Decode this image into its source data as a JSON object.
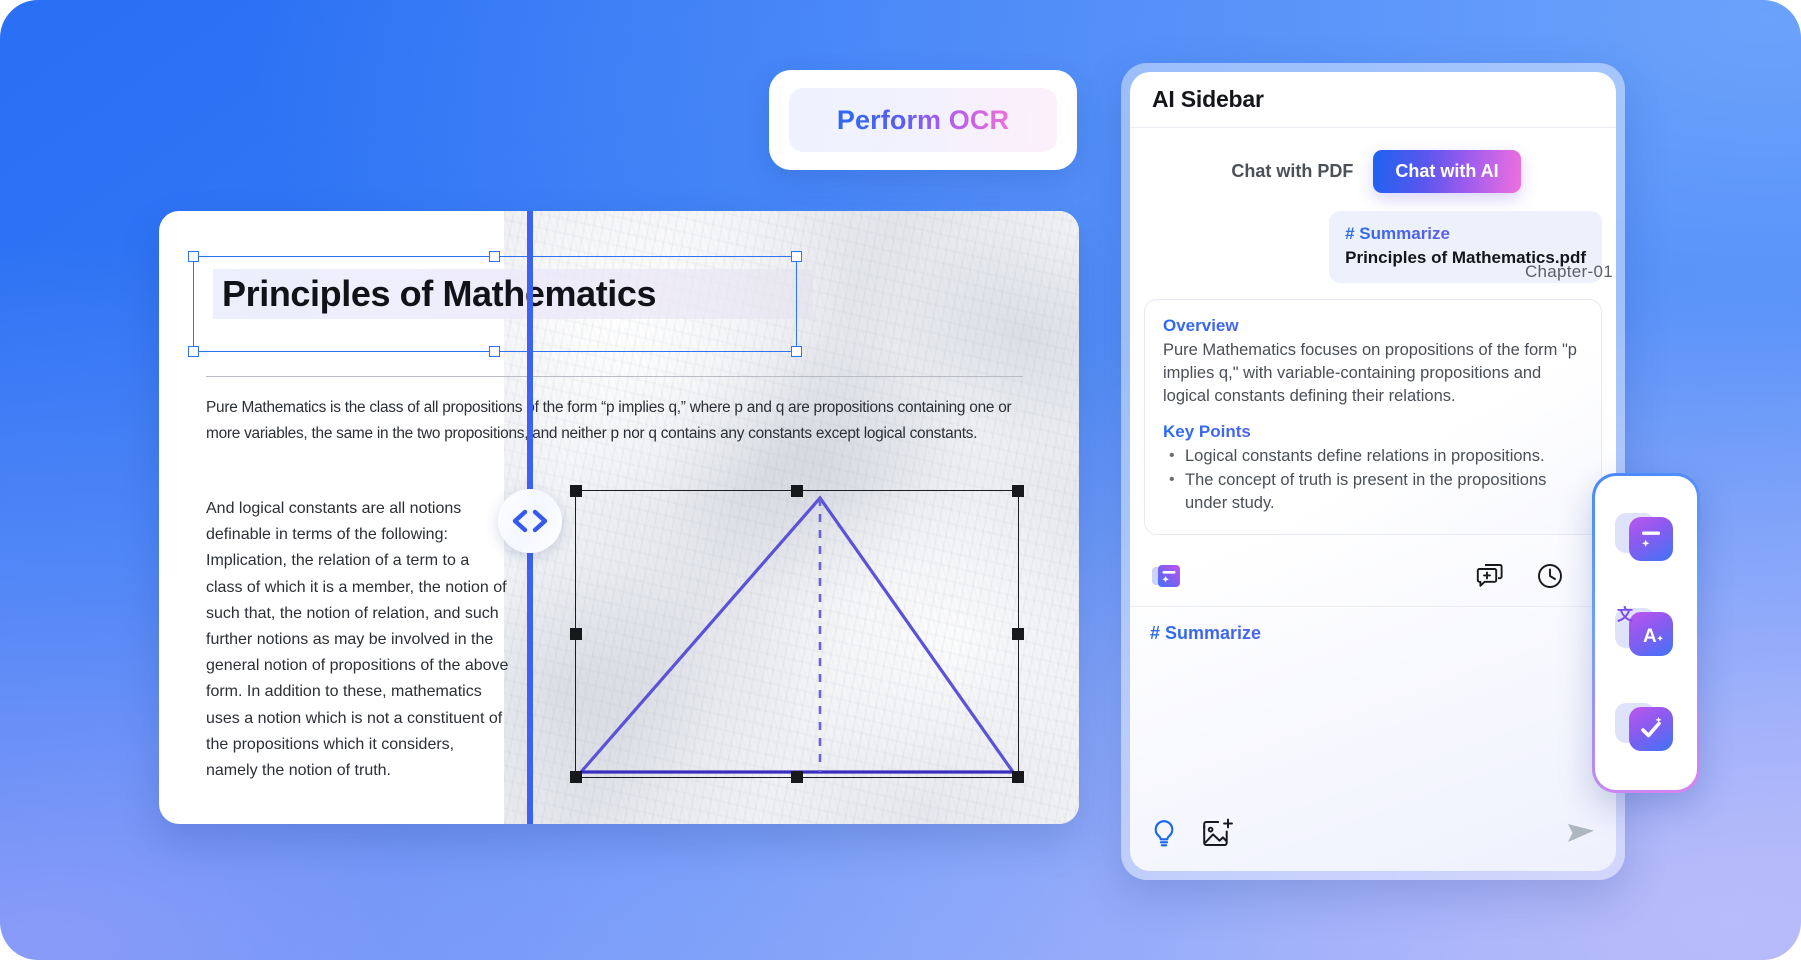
{
  "ocr": {
    "button_label": "Perform OCR"
  },
  "document": {
    "chapter_label": "Chapter-01",
    "title": "Principles of Mathematics",
    "paragraph_top": "Pure Mathematics is the class of all propositions of the form “p implies q,” where p and q are propositions containing one or more variables, the same in the two propositions, and neither p nor q contains any constants except logical constants.",
    "paragraph_left": "And logical constants are all notions definable in terms of the following: Implication, the relation of a term to a class of which it is a member, the notion of such that, the notion of relation, and such further notions as may be involved in the general notion of propositions of the above form. In addition to these, mathematics uses a notion which is not a constituent of the propositions which it considers, namely the notion of truth.",
    "split_handle_icon": "chevron-left-right-icon",
    "figure": {
      "name": "triangle-with-altitude",
      "stroke_color": "#5b52d8"
    },
    "selection_color": "#2f73f5"
  },
  "sidebar": {
    "title": "AI Sidebar",
    "tabs": [
      {
        "label": "Chat with PDF",
        "active": false
      },
      {
        "label": "Chat with AI",
        "active": true
      }
    ],
    "user_message": {
      "tag": "# Summarize",
      "file": "Principles of Mathematics.pdf"
    },
    "answer": {
      "overview_heading": "Overview",
      "overview_text": "Pure Mathematics focuses on propositions of the form \"p implies q,\" with variable-containing propositions and logical constants defining their relations.",
      "keypoints_heading": "Key Points",
      "keypoints": [
        "Logical constants define relations in propositions.",
        "The concept of truth is present in the propositions under study."
      ]
    },
    "toolbar": {
      "left_icon": "ai-assistant-icon",
      "right_icons": [
        "new-chat-icon",
        "history-clock-icon",
        "settings-icon"
      ]
    },
    "composer": {
      "tag": "# Summarize",
      "lightbulb_icon": "lightbulb-icon",
      "image_icon": "add-image-icon",
      "send_icon": "send-icon"
    }
  },
  "tool_rail": {
    "items": [
      {
        "name": "summarize-tool",
        "icon": "document-sparkle-icon"
      },
      {
        "name": "translate-tool",
        "icon": "translate-a-icon"
      },
      {
        "name": "proofread-tool",
        "icon": "checkmark-sparkle-icon"
      }
    ]
  },
  "theme": {
    "background_blue": "#2a6ff4",
    "background_lavender": "#a8b6f9",
    "accent_gradient_start": "#1e62f0",
    "accent_gradient_end": "#ef6fe0",
    "split_line": "#3d62f0"
  }
}
